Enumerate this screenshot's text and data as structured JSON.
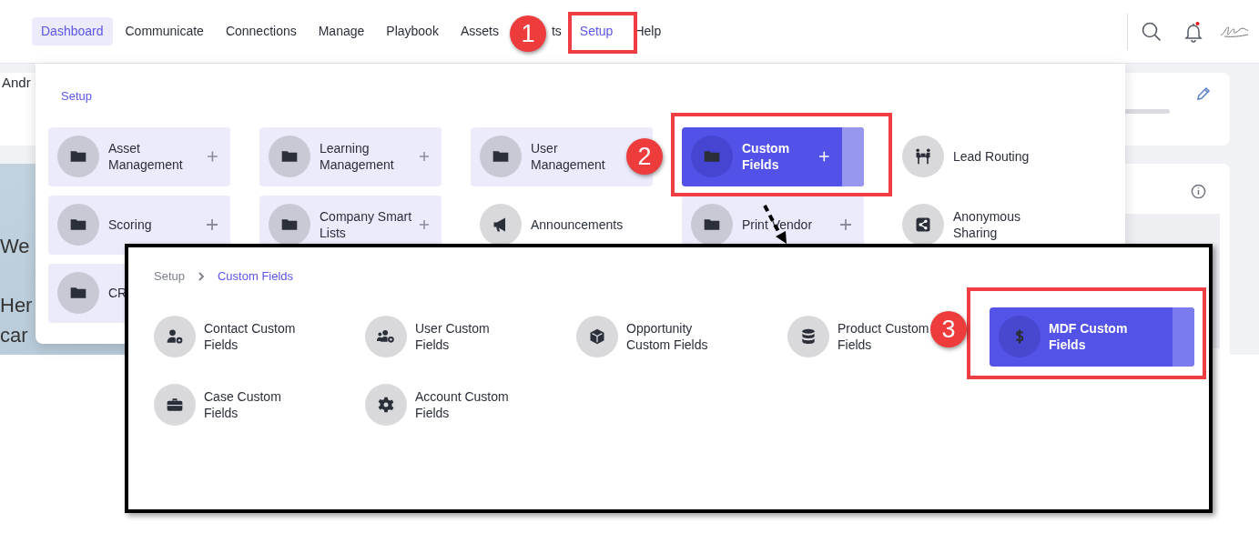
{
  "nav": {
    "items": [
      {
        "label": "Dashboard",
        "selected": true,
        "open": false
      },
      {
        "label": "Communicate",
        "selected": false,
        "open": false
      },
      {
        "label": "Connections",
        "selected": false,
        "open": false
      },
      {
        "label": "Manage",
        "selected": false,
        "open": false
      },
      {
        "label": "Playbook",
        "selected": false,
        "open": false
      },
      {
        "label": "Assets",
        "selected": false,
        "open": false
      },
      {
        "label": "ts",
        "selected": false,
        "open": false
      },
      {
        "label": "Setup",
        "selected": false,
        "open": true
      },
      {
        "label": "Help",
        "selected": false,
        "open": false
      }
    ]
  },
  "background": {
    "greeting": "Andr",
    "banner_lines": [
      "We",
      "Her",
      "car"
    ]
  },
  "setup_menu": {
    "title": "Setup",
    "tiles": [
      {
        "label": "Asset Management",
        "kind": "folder",
        "plus": true,
        "selected": false
      },
      {
        "label": "Learning Management",
        "kind": "folder",
        "plus": true,
        "selected": false
      },
      {
        "label": "User Management",
        "kind": "folder",
        "selected": false
      },
      {
        "label": "Custom Fields",
        "kind": "folder",
        "plus": true,
        "selected": true
      },
      {
        "label": "Lead Routing",
        "kind": "link",
        "selected": false
      },
      {
        "label": "Scoring",
        "kind": "folder",
        "plus": true,
        "selected": false
      },
      {
        "label": "Company Smart Lists",
        "kind": "folder",
        "plus": true,
        "selected": false
      },
      {
        "label": "Announcements",
        "kind": "link",
        "selected": false
      },
      {
        "label": "Print Vendor",
        "kind": "folder",
        "plus": true,
        "selected": false
      },
      {
        "label": "Anonymous Sharing",
        "kind": "link",
        "selected": false
      },
      {
        "label": "CR",
        "kind": "folder",
        "selected": false
      }
    ]
  },
  "custom_fields_panel": {
    "breadcrumb": [
      "Setup",
      "Custom Fields"
    ],
    "items": [
      {
        "label": "Contact Custom Fields",
        "selected": false
      },
      {
        "label": "User Custom Fields",
        "selected": false
      },
      {
        "label": "Opportunity Custom Fields",
        "selected": false
      },
      {
        "label": "Product Custom Fields",
        "selected": false
      },
      {
        "label": "MDF Custom Fields",
        "selected": true
      },
      {
        "label": "Case Custom Fields",
        "selected": false
      },
      {
        "label": "Account Custom Fields",
        "selected": false
      }
    ]
  },
  "callouts": [
    {
      "number": "1"
    },
    {
      "number": "2"
    },
    {
      "number": "3"
    }
  ]
}
